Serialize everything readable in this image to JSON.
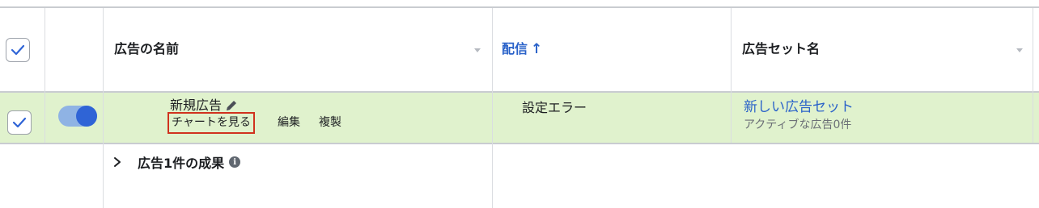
{
  "header": {
    "name_col": "広告の名前",
    "delivery_col": "配信",
    "delivery_sort_arrow": "↑",
    "adset_col": "広告セット名"
  },
  "row": {
    "ad_name": "新規広告",
    "toggle_state": "on",
    "view_chart": "チャートを見る",
    "edit": "編集",
    "duplicate": "複製",
    "delivery_status": "設定エラー",
    "adset_name": "新しい広告セット",
    "adset_sub": "アクティブな広告0件"
  },
  "summary": {
    "label": "広告1件の成果"
  },
  "colors": {
    "row_highlight": "#e0f2cd",
    "link_blue": "#2a62c9",
    "toggle_on": "#2f64d6",
    "highlight_box": "#d0321e"
  }
}
